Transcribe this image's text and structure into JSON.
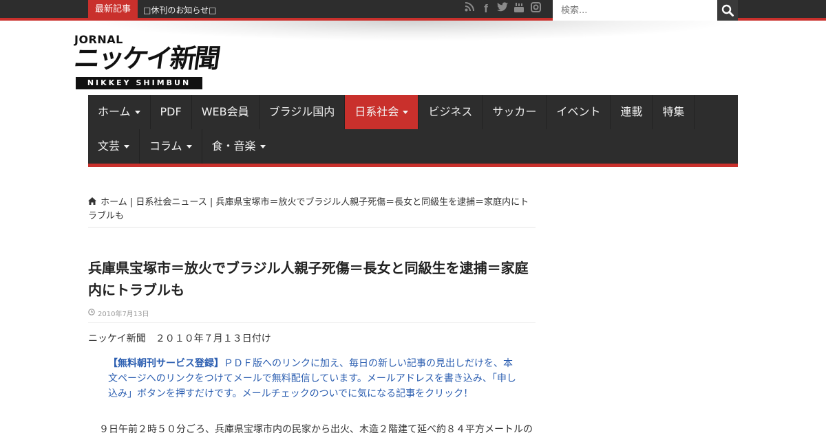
{
  "topbar": {
    "breaking_label": "最新記事",
    "breaking_text": "□休刊のお知らせ□",
    "search_placeholder": "検索...",
    "social_icons": [
      "rss-icon",
      "facebook-icon",
      "twitter-icon",
      "youtube-icon",
      "instagram-icon"
    ]
  },
  "logo": {
    "top": "JORNAL",
    "main": "ニッケイ新聞",
    "bottom": "NIKKEY SHIMBUN"
  },
  "nav": {
    "row1": [
      {
        "label": "ホーム",
        "dropdown": true
      },
      {
        "label": "PDF",
        "dropdown": false
      },
      {
        "label": "WEB会員",
        "dropdown": false
      },
      {
        "label": "ブラジル国内",
        "dropdown": false
      },
      {
        "label": "日系社会",
        "dropdown": true,
        "active": true
      },
      {
        "label": "ビジネス",
        "dropdown": false
      },
      {
        "label": "サッカー",
        "dropdown": false
      },
      {
        "label": "イベント",
        "dropdown": false
      },
      {
        "label": "連載",
        "dropdown": false
      },
      {
        "label": "特集",
        "dropdown": false
      }
    ],
    "row2": [
      {
        "label": "文芸",
        "dropdown": true
      },
      {
        "label": "コラム",
        "dropdown": true
      },
      {
        "label": "食・音楽",
        "dropdown": true
      }
    ]
  },
  "breadcrumb": {
    "home": "ホーム",
    "category": "日系社会ニュース",
    "current": "兵庫県宝塚市＝放火でブラジル人親子死傷＝長女と同級生を逮捕＝家庭内にトラブルも"
  },
  "article": {
    "title": "兵庫県宝塚市＝放火でブラジル人親子死傷＝長女と同級生を逮捕＝家庭内にトラブルも",
    "date": "2010年7月13日",
    "source": "ニッケイ新聞　２０１０年７月１３日付け",
    "promo_bold": "【無料朝刊サービス登録】",
    "promo_text": "ＰＤＦ版へのリンクに加え、毎日の新しい記事の見出しだけを、本文ページへのリンクをつけてメールで無料配信しています。メールアドレスを書き込み、「申し込み」ボタンを押すだけです。メールチェックのついでに気になる記事をクリック！",
    "body_first_line": "９日午前２時５０分ごろ、兵庫県宝塚市内の民家から出火、木造２階建て延べ約８４平方メートルの"
  },
  "colors": {
    "accent_red": "#c9302c",
    "dark_bar": "#2d2d2d",
    "link_blue": "#2a5db0"
  }
}
